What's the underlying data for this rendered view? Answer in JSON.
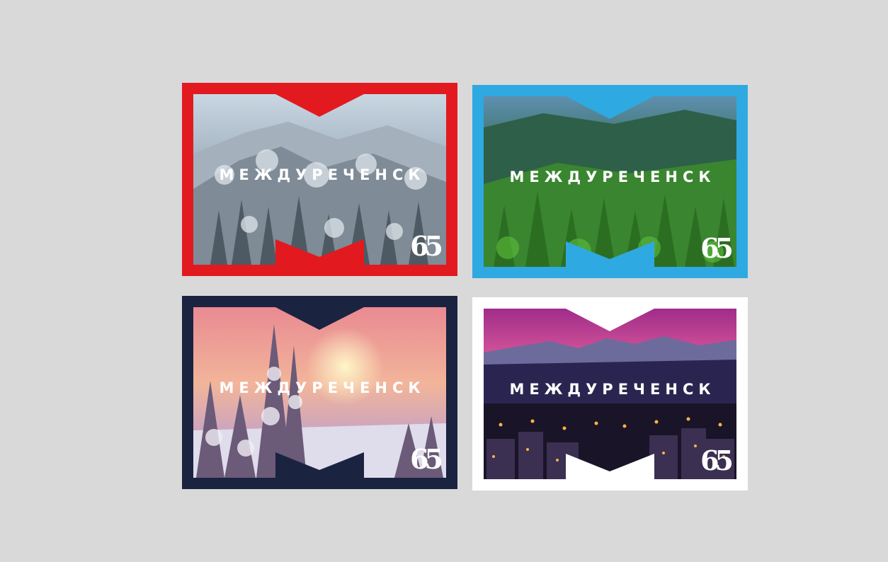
{
  "cards": [
    {
      "title": "МЕЖДУРЕЧЕНСК",
      "badge": "65",
      "frame_color": "#e21a1f",
      "theme": "snowy-forest"
    },
    {
      "title": "МЕЖДУРЕЧЕНСК",
      "badge": "65",
      "frame_color": "#2fa9e1",
      "theme": "green-forest"
    },
    {
      "title": "МЕЖДУРЕЧЕНСК",
      "badge": "65",
      "frame_color": "#1a2340",
      "theme": "pink-winter-sunset"
    },
    {
      "title": "МЕЖДУРЕЧЕНСК",
      "badge": "65",
      "frame_color": "#ffffff",
      "theme": "night-city-mountains"
    }
  ]
}
